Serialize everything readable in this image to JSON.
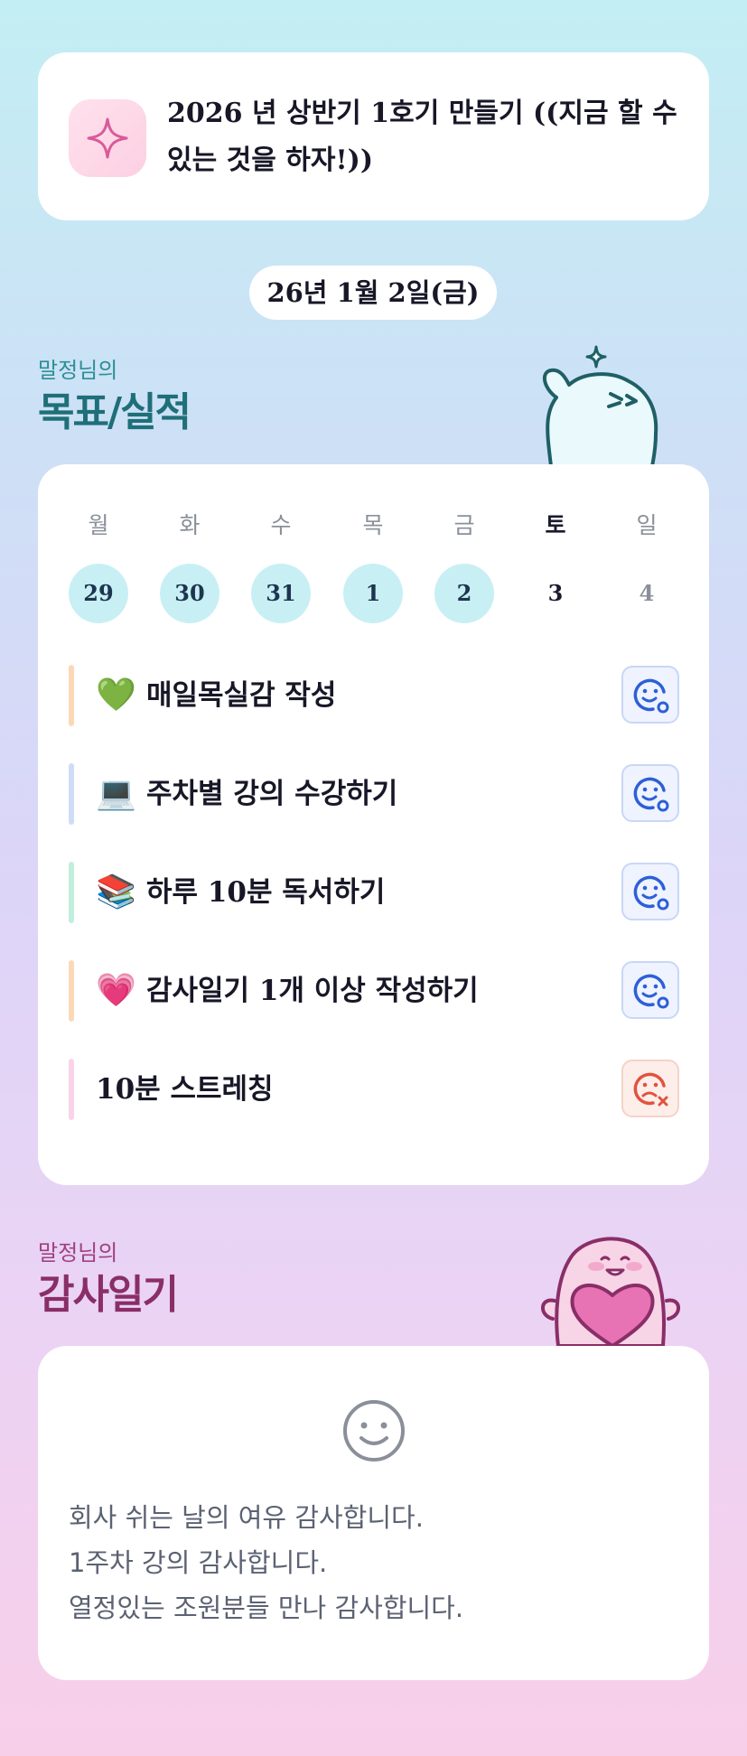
{
  "header": {
    "icon": "sparkle-icon",
    "title": "2026 년 상반기 1호기 만들기 ((지금 할 수 있는 것을 하자!))"
  },
  "date": "26년 1월 2일(금)",
  "goals": {
    "subtitle": "말정님의",
    "title": "목표/실적",
    "week": [
      {
        "day": "월",
        "date": "29",
        "done": true
      },
      {
        "day": "화",
        "date": "30",
        "done": true
      },
      {
        "day": "수",
        "date": "31",
        "done": true
      },
      {
        "day": "목",
        "date": "1",
        "done": true
      },
      {
        "day": "금",
        "date": "2",
        "done": true
      },
      {
        "day": "토",
        "date": "3",
        "done": false
      },
      {
        "day": "일",
        "date": "4",
        "done": false
      }
    ],
    "items": [
      {
        "emoji": "💚",
        "label": "매일목실감 작성",
        "status": "done",
        "bar_color": "#fbd9b8"
      },
      {
        "emoji": "💻",
        "label": "주차별 강의 수강하기",
        "status": "done",
        "bar_color": "#cfdcf8"
      },
      {
        "emoji": "📚",
        "label": "하루 10분 독서하기",
        "status": "done",
        "bar_color": "#c2eedd"
      },
      {
        "emoji": "💗",
        "label": "감사일기 1개 이상 작성하기",
        "status": "done",
        "bar_color": "#fbd9b8"
      },
      {
        "emoji": "",
        "label": "10분 스트레칭",
        "status": "not-done",
        "bar_color": "#f9d3ea"
      }
    ]
  },
  "gratitude": {
    "subtitle": "말정님의",
    "title": "감사일기",
    "icon": "smile-icon",
    "lines": [
      "회사 쉬는 날의 여유 감사합니다.",
      "1주차 강의 감사합니다.",
      "열정있는 조원분들 만나 감사합니다."
    ]
  },
  "colors": {
    "accent_teal": "#1f6f78",
    "accent_pink": "#8a2e67",
    "done_circle": "#c8f0f4",
    "status_ok": "#2d5fd6",
    "status_fail": "#e0533e"
  }
}
